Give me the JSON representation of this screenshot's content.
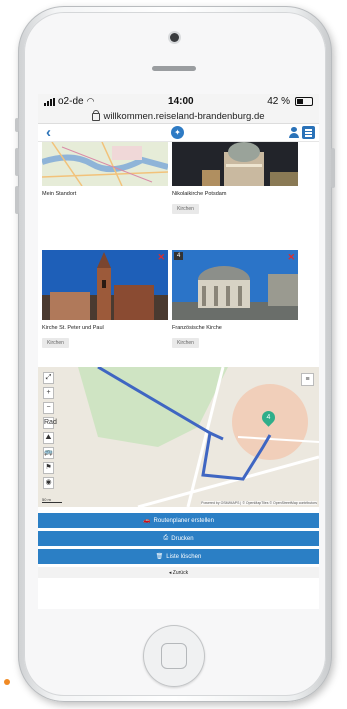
{
  "status": {
    "carrier": "o2-de",
    "time": "14:00",
    "battery": "42 %"
  },
  "browser": {
    "url": "willkommen.reiseland-brandenburg.de"
  },
  "navbar": {
    "back_icon": "chevron-left-icon",
    "compass_icon": "compass-icon",
    "user_icon": "user-icon",
    "menu_icon": "hamburger-menu-icon"
  },
  "cards": [
    {
      "caption": "Mein Standort",
      "tag": ""
    },
    {
      "caption": "Nikolaikirche Potsdam",
      "tag": "Kirchen"
    },
    {
      "caption": "Kirche St. Peter und Paul",
      "tag": "Kirchen"
    },
    {
      "caption": "Französische Kirche",
      "tag": "Kirchen",
      "number": "4"
    }
  ],
  "map": {
    "controls": [
      "⤢",
      "+",
      "−",
      "Rad",
      "⛰",
      "🚌",
      "⚑",
      "◉"
    ],
    "marker": "4",
    "attribution": "Powered by OSM/MAPS | © OpenMapTiles © OpenStreetMap contributors",
    "scale": "50 m"
  },
  "actions": {
    "route_label": "Routenplaner erstellen",
    "print_label": "Drucken",
    "delete_label": "Liste löschen",
    "back_label": "◂ Zurück"
  },
  "colors": {
    "accent": "#2b7fc5",
    "route": "#3f66c2",
    "remove": "#e02b2b"
  }
}
